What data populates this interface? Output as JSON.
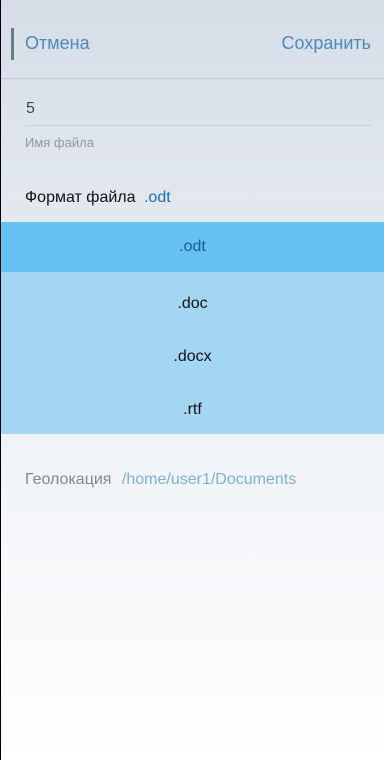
{
  "header": {
    "cancel_label": "Отмена",
    "save_label": "Сохранить"
  },
  "file_name": {
    "value": "5",
    "label": "Имя файла"
  },
  "format": {
    "label": "Формат файла",
    "selected_value": ".odt",
    "options": [
      ".odt",
      ".doc",
      ".docx",
      ".rtf"
    ]
  },
  "location": {
    "label": "Геолокация",
    "path": "/home/user1/Documents"
  }
}
